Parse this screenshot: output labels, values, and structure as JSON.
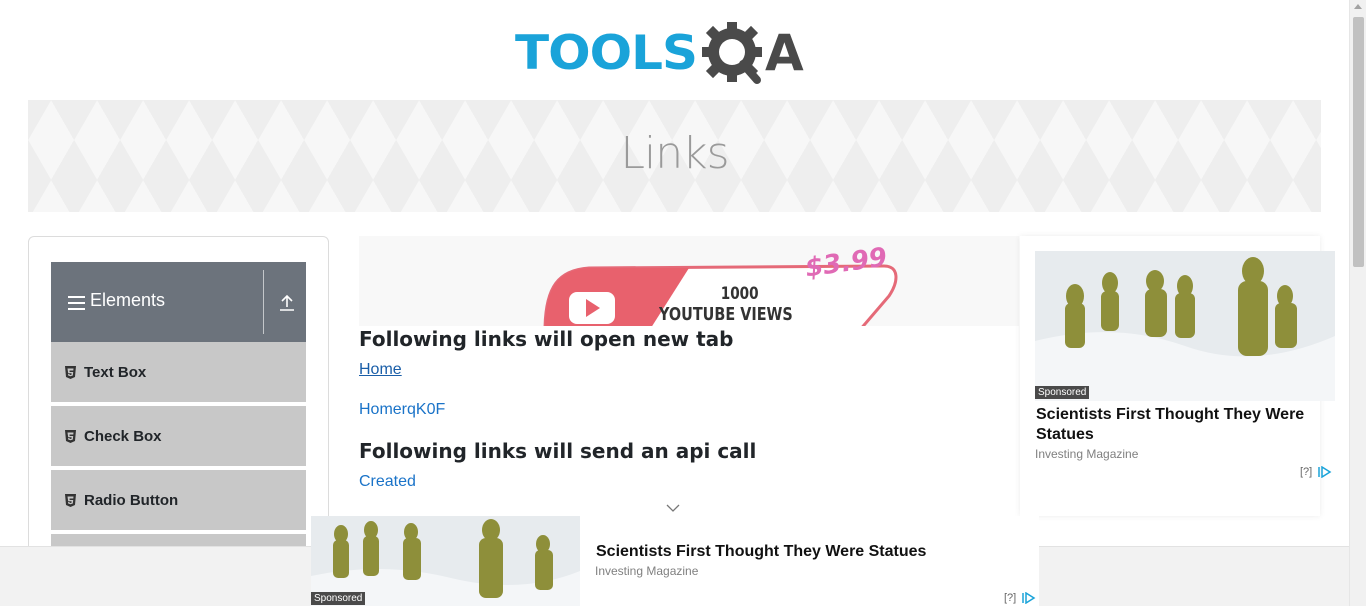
{
  "header": {
    "logo_text": "TOOLS",
    "logo_suffix": "A"
  },
  "banner": {
    "title": "Links"
  },
  "sidebar": {
    "group_title": "Elements",
    "items": [
      {
        "label": "Text Box"
      },
      {
        "label": "Check Box"
      },
      {
        "label": "Radio Button"
      }
    ]
  },
  "top_ad": {
    "price": "$3.99",
    "line1": "1000",
    "line2": "YOUTUBE VIEWS"
  },
  "main": {
    "section1_title": "Following links will open new tab",
    "link_home": "Home",
    "link_home_dynamic": "HomerqK0F",
    "section2_title": "Following links will send an api call",
    "link_created": "Created"
  },
  "right_ad": {
    "sponsored": "Sponsored",
    "title": "Scientists First Thought They Were Statues",
    "source": "Investing Magazine",
    "info": "[?]"
  },
  "bottom_ad": {
    "sponsored": "Sponsored",
    "title": "Scientists First Thought They Were Statues",
    "source": "Investing Magazine",
    "info": "[?]"
  },
  "colors": {
    "logo_blue": "#1aa3d9",
    "logo_dark": "#4a4a4a",
    "sidebar_header": "#6c737c",
    "menu_item": "#c8c8c8",
    "link": "#1a73c8"
  }
}
